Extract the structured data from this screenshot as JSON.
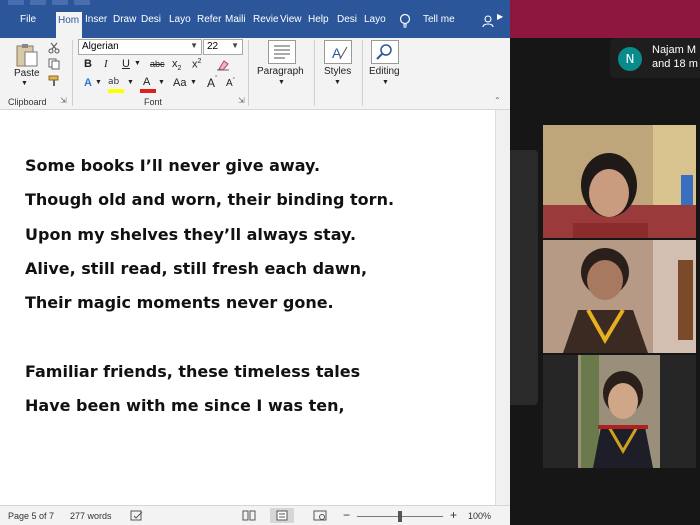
{
  "ribbon_tabs": [
    {
      "label": "File"
    },
    {
      "label": "Hom"
    },
    {
      "label": "Inser"
    },
    {
      "label": "Draw"
    },
    {
      "label": "Desi"
    },
    {
      "label": "Layo"
    },
    {
      "label": "Refer"
    },
    {
      "label": "Maili"
    },
    {
      "label": "Revie"
    },
    {
      "label": "View"
    },
    {
      "label": "Help"
    },
    {
      "label": "Desi"
    },
    {
      "label": "Layo"
    }
  ],
  "tell_me": "Tell me",
  "clipboard": {
    "paste_label": "Paste",
    "group_label": "Clipboard"
  },
  "font": {
    "name": "Algerian",
    "size": "22",
    "group_label": "Font",
    "aa_label": "Aa"
  },
  "paragraph_label": "Paragraph",
  "styles_label": "Styles",
  "editing_label": "Editing",
  "poem_lines": [
    "Some books I’ll never give away.",
    "Though old and worn, their binding torn.",
    "Upon my shelves they’ll always stay.",
    "Alive, still read, still fresh each dawn,",
    "Their magic moments never gone.",
    "Familiar friends, these timeless tales",
    "Have been with me since I was ten,"
  ],
  "status": {
    "page": "Page 5 of 7",
    "words": "277 words",
    "zoom": "100%"
  },
  "meeting": {
    "notify_initial": "N",
    "notify_line1": "Najam M",
    "notify_line2": "and 18 m"
  },
  "colors": {
    "word_blue": "#2b579a",
    "meeting_bar": "#8e1740",
    "avatar": "#0a8b8b"
  }
}
